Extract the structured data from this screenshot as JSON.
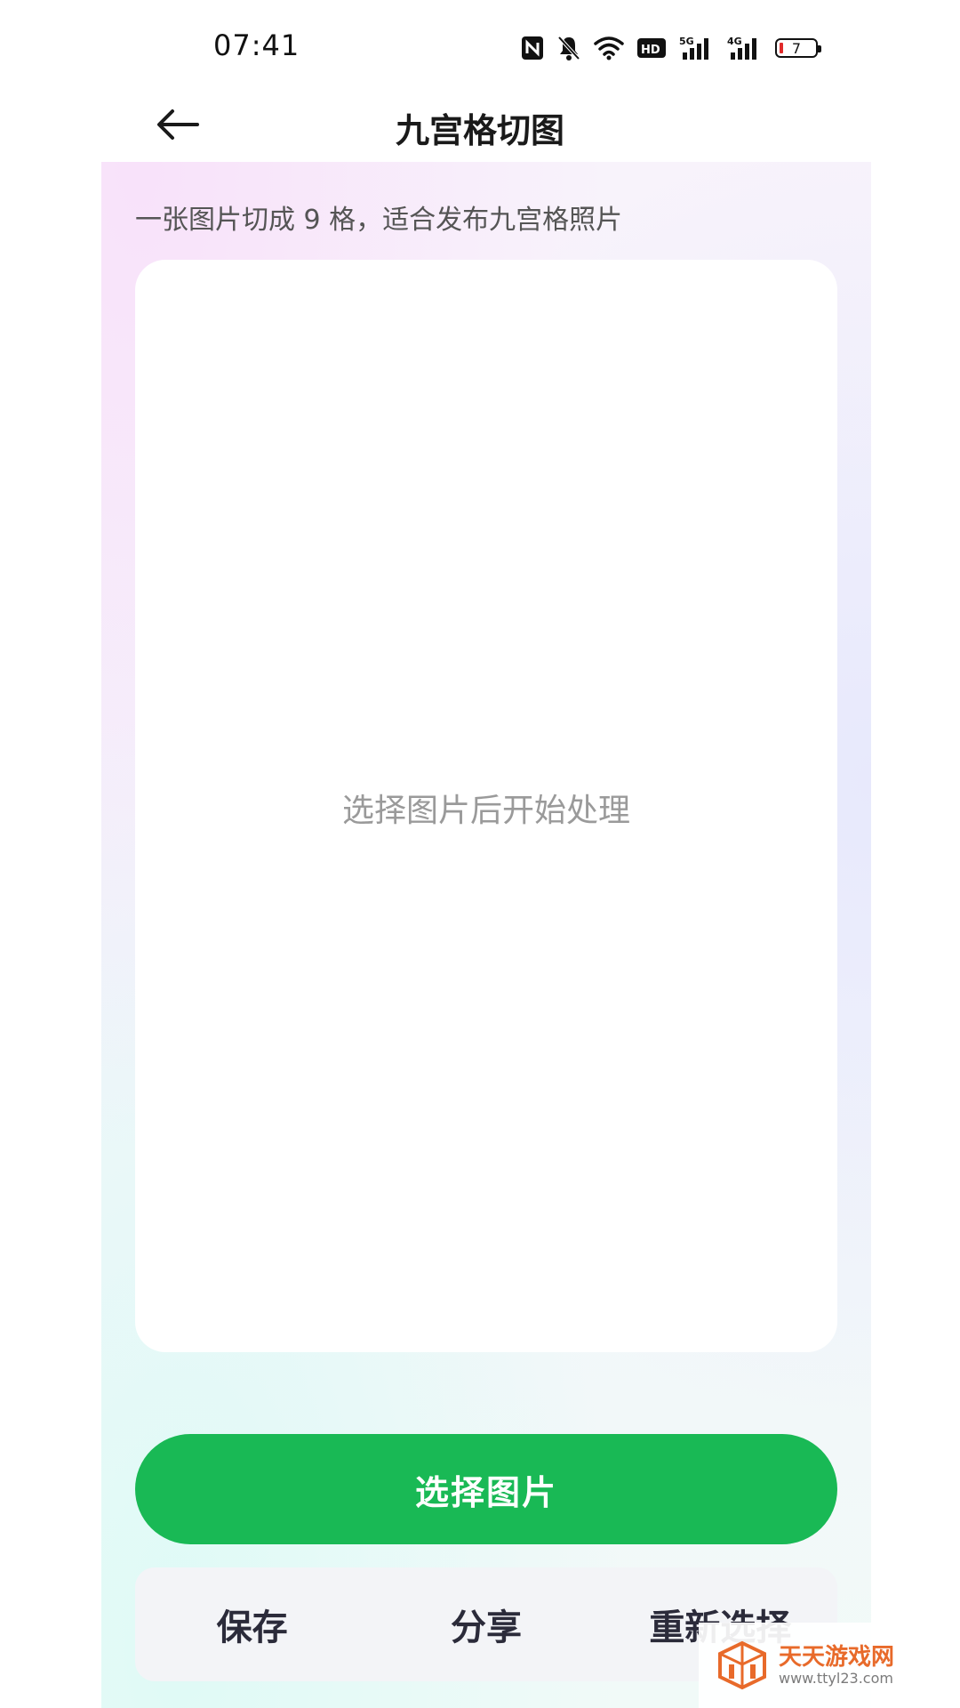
{
  "status_bar": {
    "time": "07:41",
    "icons": [
      "nfc-icon",
      "mute-bell-icon",
      "wifi-icon",
      "hd-icon",
      "5g-signal-icon",
      "4g-signal-icon",
      "battery-icon"
    ],
    "battery_level": "7",
    "colors": {
      "battery_low": "#e02a2a"
    }
  },
  "header": {
    "back_icon": "arrow-left-icon",
    "title": "九宫格切图"
  },
  "content": {
    "subtitle": "一张图片切成 9 格，适合发布九宫格照片",
    "preview_placeholder": "选择图片后开始处理",
    "select_button": "选择图片",
    "accent_color": "#19b955",
    "actions": {
      "save": "保存",
      "share": "分享",
      "reselect": "重新选择"
    }
  },
  "watermark": {
    "title": "天天游戏网",
    "url": "www.ttyl23.com"
  }
}
